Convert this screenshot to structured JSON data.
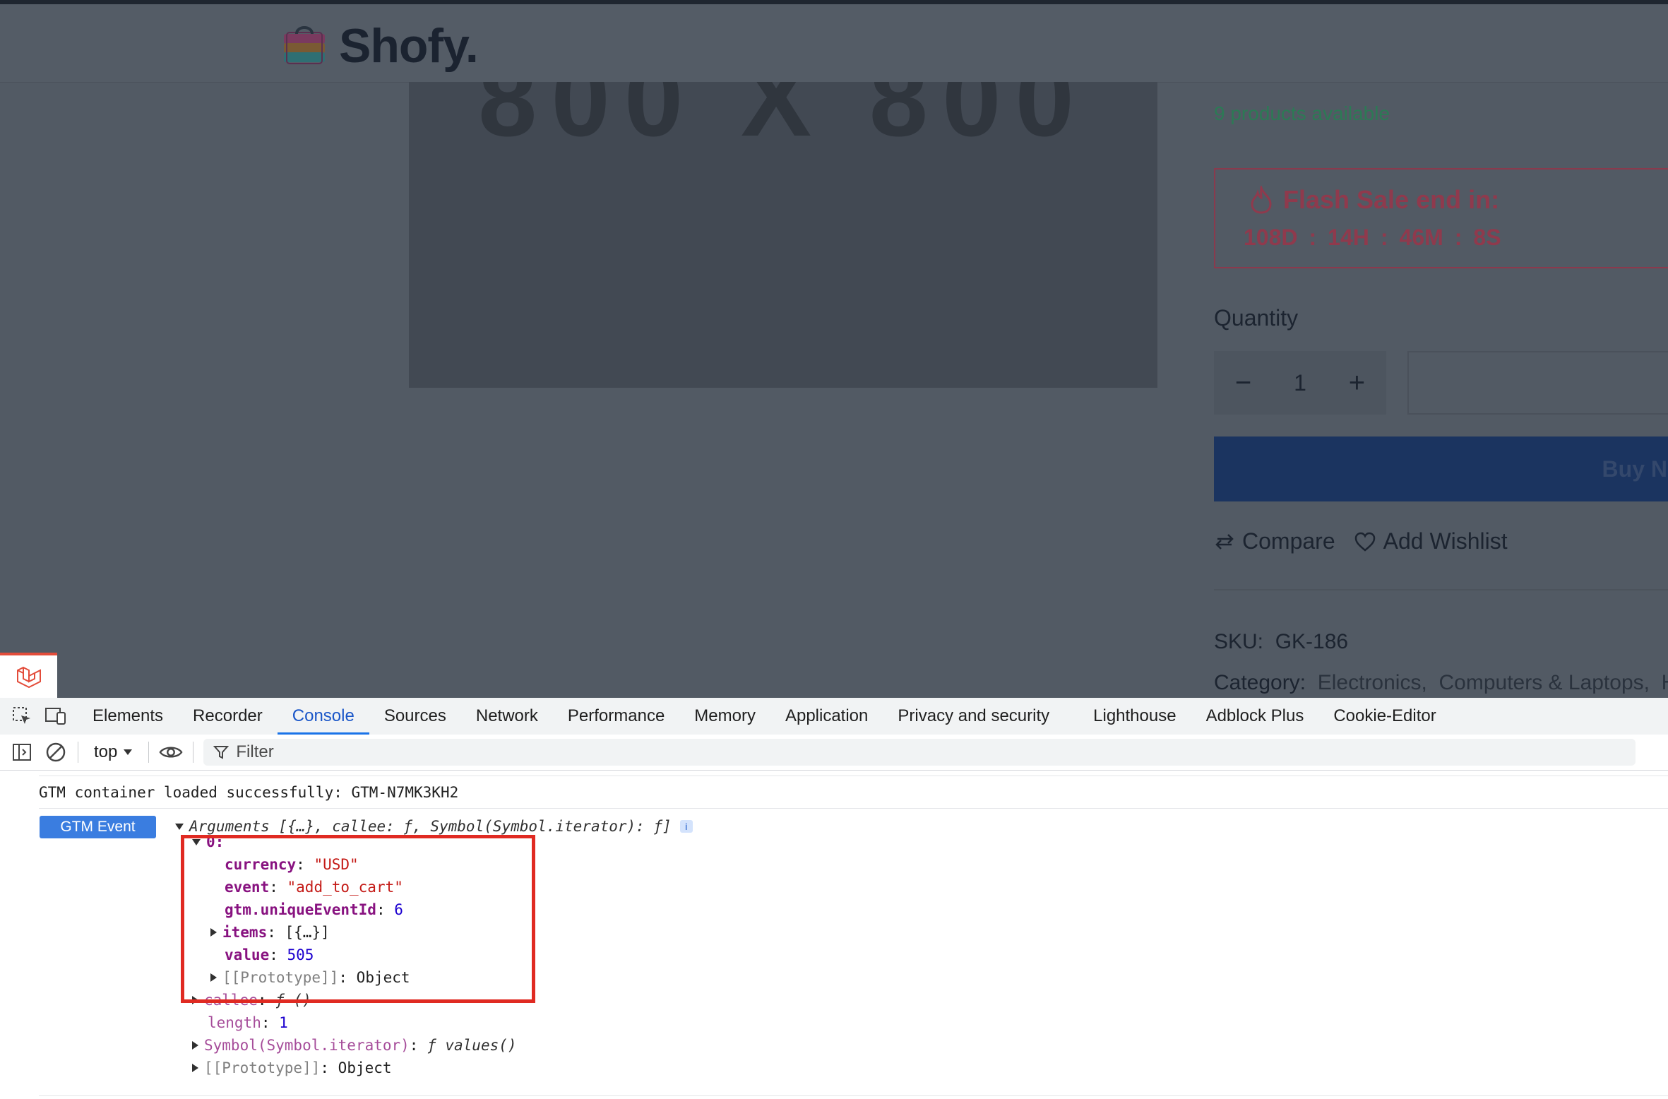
{
  "site": {
    "logo_text": "Shofy."
  },
  "product": {
    "image_placeholder": "800 X 800",
    "availability": "9 products available",
    "flash_sale": {
      "title": "Flash Sale end in:",
      "days": "108D",
      "hours": "14H",
      "minutes": "46M",
      "seconds": "8S",
      "separator": ":"
    },
    "quantity": {
      "label": "Quantity",
      "value": "1",
      "minus": "−",
      "plus": "+"
    },
    "buy_label": "Buy N",
    "compare_label": "Compare",
    "wishlist_label": "Add Wishlist",
    "sku_label": "SKU:",
    "sku_value": "GK-186",
    "category_label": "Category:",
    "categories": [
      "Electronics,",
      "Computers & Laptops,",
      "H"
    ]
  },
  "devtools": {
    "tabs": [
      "Elements",
      "Recorder",
      "Console",
      "Sources",
      "Network",
      "Performance",
      "Memory",
      "Application",
      "Privacy and security",
      "Lighthouse",
      "Adblock Plus",
      "Cookie-Editor"
    ],
    "active_tab": "Console",
    "context": "top",
    "filter_placeholder": "Filter",
    "console": {
      "log_message": "GTM container loaded successfully: GTM-N7MK3KH2",
      "badge": "GTM Event",
      "arguments_header": "Arguments [{…}, callee: ƒ, Symbol(Symbol.iterator): ƒ]",
      "info": "i",
      "index": "0:",
      "currency_key": "currency",
      "currency_val": "\"USD\"",
      "event_key": "event",
      "event_val": "\"add_to_cart\"",
      "gtm_key": "gtm.uniqueEventId",
      "gtm_val": "6",
      "items_key": "items",
      "items_val": "[{…}]",
      "value_key": "value",
      "value_val": "505",
      "proto_key": "[[Prototype]]",
      "proto_val": "Object",
      "callee_key": "callee",
      "callee_val": "ƒ ()",
      "length_key": "length",
      "length_val": "1",
      "symbol_key": "Symbol(Symbol.iterator)",
      "symbol_val": "ƒ values()",
      "proto2_key": "[[Prototype]]",
      "proto2_val": "Object"
    }
  },
  "colors": {
    "highlight": "#e02a22",
    "active_tab": "#1a73e8",
    "badge": "#3a7de0"
  }
}
